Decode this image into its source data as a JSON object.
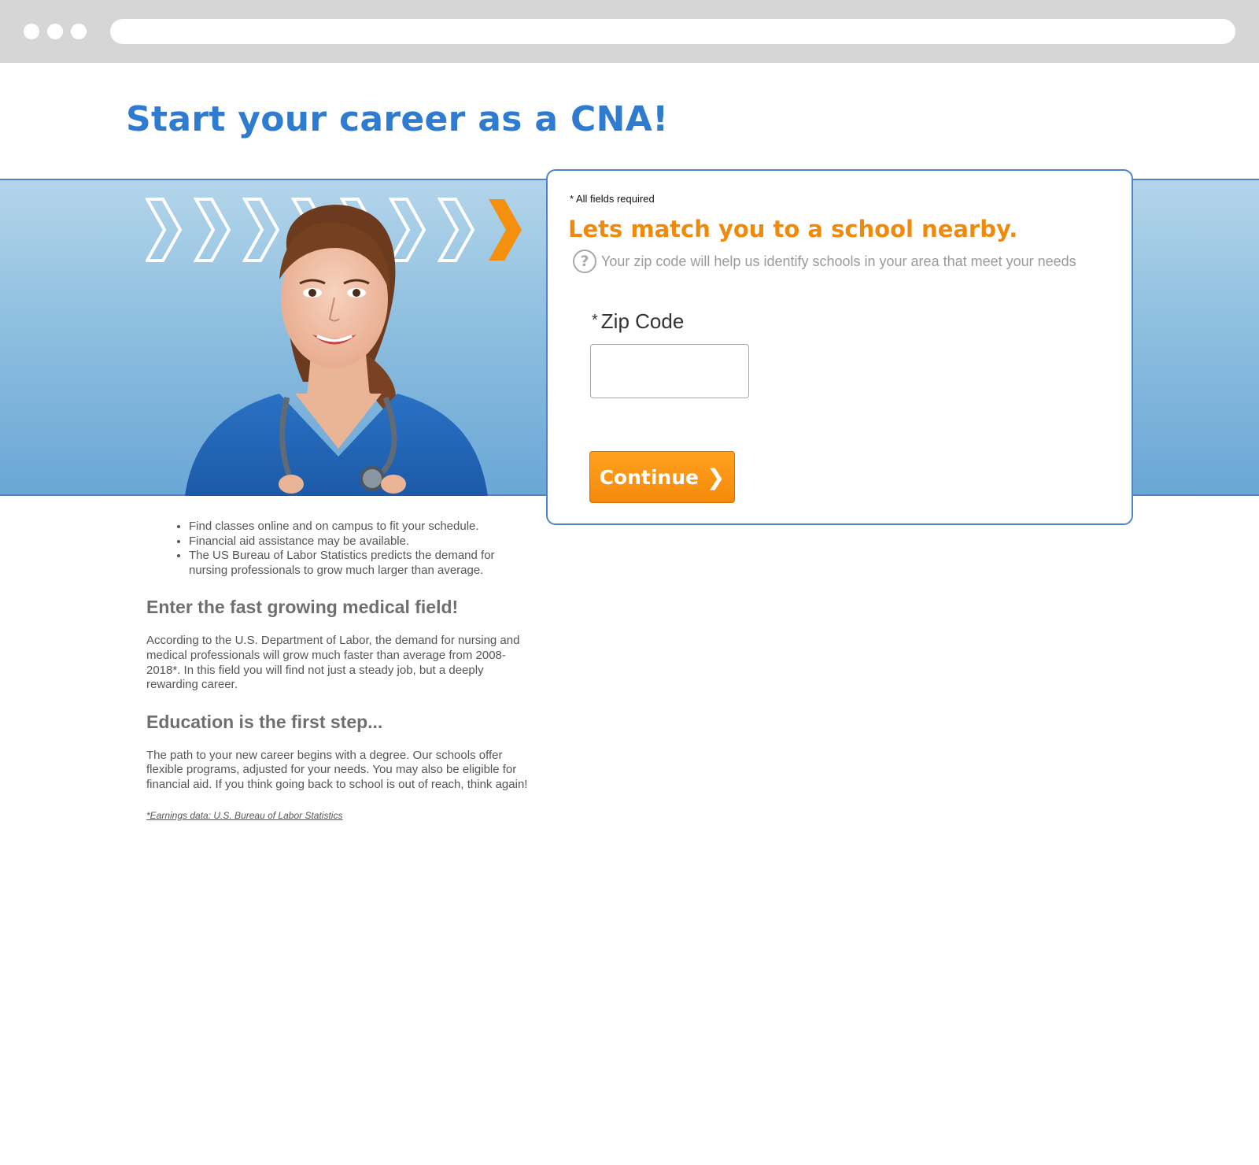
{
  "browser": {
    "url": ""
  },
  "page": {
    "headline": "Start your career as a CNA!"
  },
  "form": {
    "required_note": "* All fields required",
    "title": "Lets match you to a school nearby.",
    "help_icon": "question-circle-icon",
    "help_text": "Your zip code will help us identify schools in your area that meet your needs",
    "zip": {
      "asterisk": "*",
      "label": "Zip Code",
      "value": "",
      "placeholder": ""
    },
    "continue_label": "Continue",
    "continue_icon": "chevron-right-icon"
  },
  "benefits": [
    "Find classes online and on campus to fit your schedule.",
    "Financial aid assistance may be available.",
    "The US Bureau of Labor Statistics predicts the demand for nursing professionals to grow much larger than average."
  ],
  "sections": [
    {
      "heading": "Enter the fast growing medical field!",
      "body": "According to the U.S. Department of Labor, the demand for nursing and medical professionals will grow much faster than average from 2008-2018*. In this field you will find not just a steady job, but a deeply rewarding career."
    },
    {
      "heading": "Education is the first step...",
      "body": "The path to your new career begins with a degree. Our schools offer flexible programs, adjusted for your needs. You may also be eligible for financial aid. If you think going back to school is out of reach, think again!"
    }
  ],
  "footnote": "*Earnings data: U.S. Bureau of Labor Statistics",
  "colors": {
    "headline_blue": "#2f7bcf",
    "accent_orange": "#f08a0c",
    "hero_blue": "#8fbfe0"
  }
}
